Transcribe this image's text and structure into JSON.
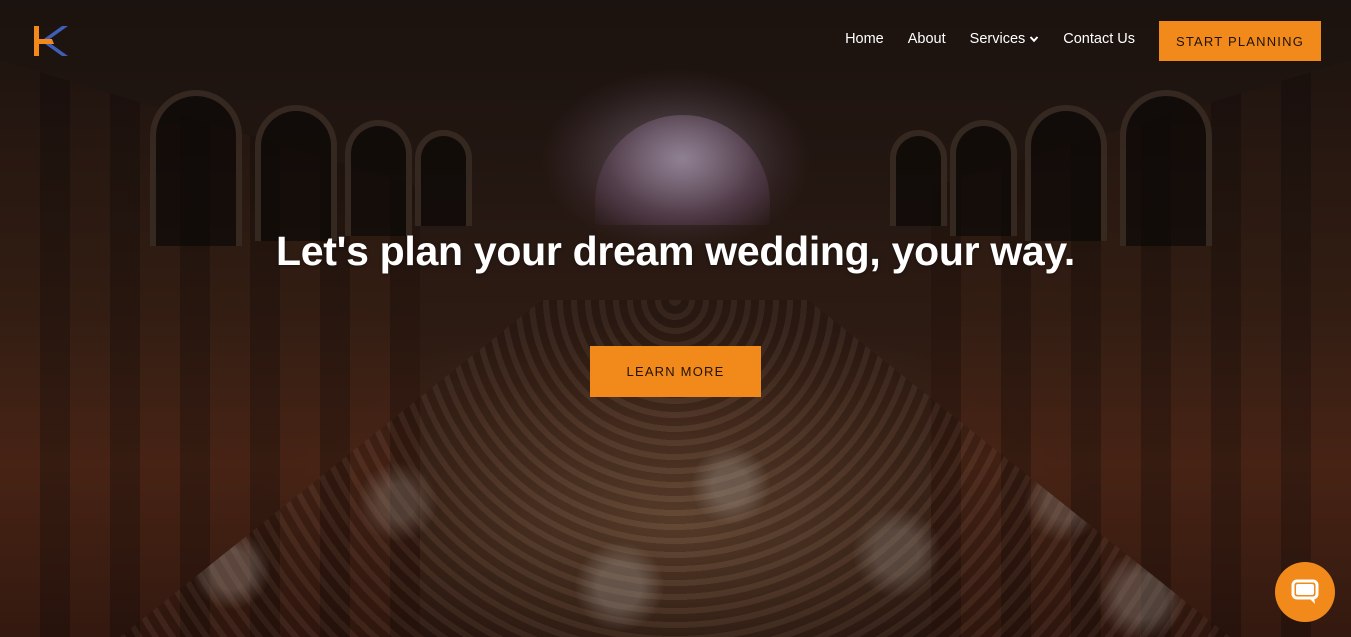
{
  "brand": {
    "logo_icon": "k-monogram-logo",
    "accent_color": "#f28a1b"
  },
  "nav": {
    "items": [
      {
        "label": "Home"
      },
      {
        "label": "About"
      },
      {
        "label": "Services",
        "has_dropdown": true
      },
      {
        "label": "Contact Us"
      }
    ],
    "cta_label": "START PLANNING"
  },
  "hero": {
    "headline": "Let's plan your dream wedding, your way.",
    "button_label": "LEARN MORE",
    "background_image": "wedding-reception-hall-photo"
  },
  "chat": {
    "icon": "chat-bubble-icon"
  }
}
